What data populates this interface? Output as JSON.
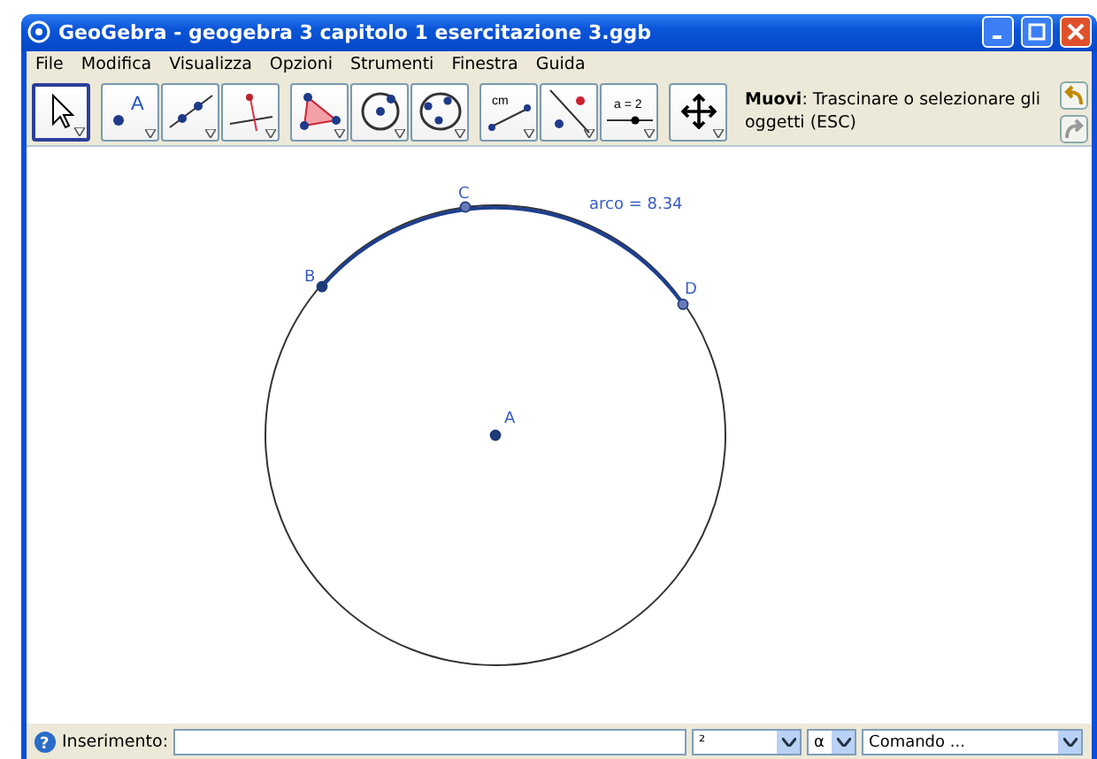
{
  "window": {
    "title": "GeoGebra - geogebra 3 capitolo 1 esercitazione 3.ggb"
  },
  "menu": [
    "File",
    "Modifica",
    "Visualizza",
    "Opzioni",
    "Strumenti",
    "Finestra",
    "Guida"
  ],
  "tool_groups": [
    [
      {
        "kind": "select",
        "selected": true
      }
    ],
    [
      {
        "kind": "point",
        "selected": false,
        "text": "A"
      },
      {
        "kind": "line",
        "selected": false
      },
      {
        "kind": "perpendicular",
        "selected": false
      }
    ],
    [
      {
        "kind": "polygon",
        "selected": false
      },
      {
        "kind": "circle",
        "selected": false
      },
      {
        "kind": "circle3",
        "selected": false
      }
    ],
    [
      {
        "kind": "distance",
        "selected": false,
        "text": "cm"
      },
      {
        "kind": "reflect",
        "selected": false
      },
      {
        "kind": "slider",
        "selected": false,
        "text": "a = 2"
      }
    ],
    [
      {
        "kind": "move",
        "selected": false
      }
    ]
  ],
  "tool_help": "**Muovi**: Trascinare o selezionare gli oggetti (ESC)",
  "canvas": {
    "points": [
      {
        "label": "A"
      },
      {
        "label": "B"
      },
      {
        "label": "C"
      },
      {
        "label": "D"
      }
    ],
    "arc_label": "arco = 8.34"
  },
  "input_bar": {
    "help": "?",
    "label": "Inserimento:",
    "symbols": "²",
    "greek": "α",
    "command": "Comando ..."
  }
}
